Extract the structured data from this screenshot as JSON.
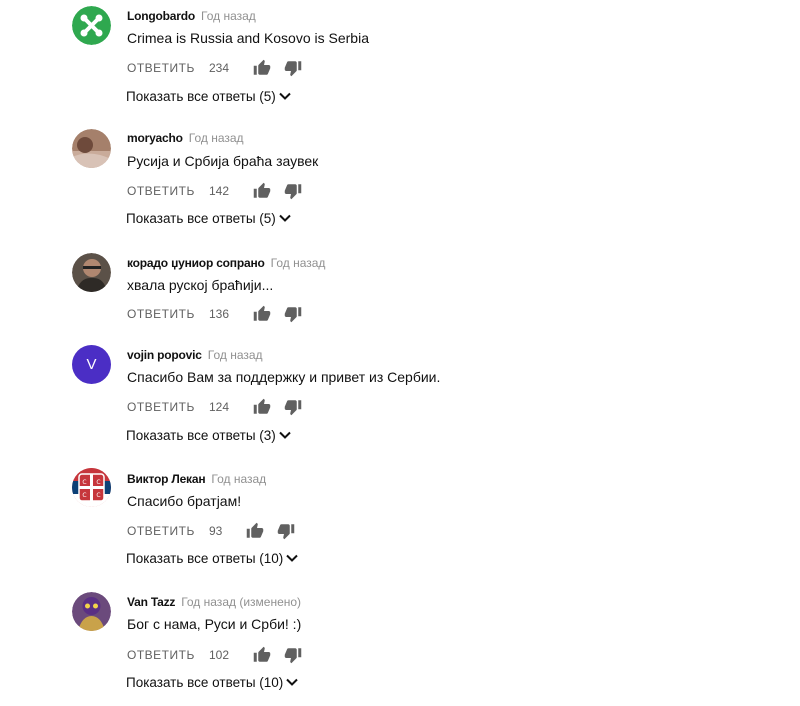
{
  "comments": [
    {
      "author": "Longobardo",
      "time": "Год назад",
      "text": "Crimea is Russia and Kosovo is Serbia",
      "reply_label": "ОТВЕТИТЬ",
      "likes": "234",
      "show_replies": "Показать все ответы (5)",
      "avatar_icon": "green-cross-avatar"
    },
    {
      "author": "moryacho",
      "time": "Год назад",
      "text": "Русија и Србија браћа заувек",
      "reply_label": "ОТВЕТИТЬ",
      "likes": "142",
      "show_replies": "Показать все ответы (5)",
      "avatar_icon": "photo-avatar"
    },
    {
      "author": "корадо џуниор сопрано",
      "time": "Год назад",
      "text": "хвала руској браћији...",
      "reply_label": "ОТВЕТИТЬ",
      "likes": "136",
      "avatar_icon": "photo-avatar"
    },
    {
      "author": "vojin popovic",
      "time": "Год назад",
      "text": "Спасибо Вам за поддержку и привет из Сербии.",
      "reply_label": "ОТВЕТИТЬ",
      "likes": "124",
      "show_replies": "Показать все ответы (3)",
      "avatar_letter": "V"
    },
    {
      "author": "Виктор Лекан",
      "time": "Год назад",
      "text": "Спасибо братјам!",
      "reply_label": "ОТВЕТИТЬ",
      "likes": "93",
      "show_replies": "Показать все ответы (10)",
      "avatar_icon": "serbian-cross-avatar"
    },
    {
      "author": "Van Tazz",
      "time": "Год назад (изменено)",
      "text": "Бог с нама, Руси и Срби! :)",
      "reply_label": "ОТВЕТИТЬ",
      "likes": "102",
      "show_replies": "Показать все ответы (10)",
      "avatar_icon": "photo-avatar"
    }
  ],
  "colors": {
    "text": "#111111",
    "muted": "#909090",
    "icon": "#606060",
    "avatar_green": "#2fa84f",
    "avatar_purple": "#4b2ec5",
    "serbia_red": "#c6363c"
  }
}
